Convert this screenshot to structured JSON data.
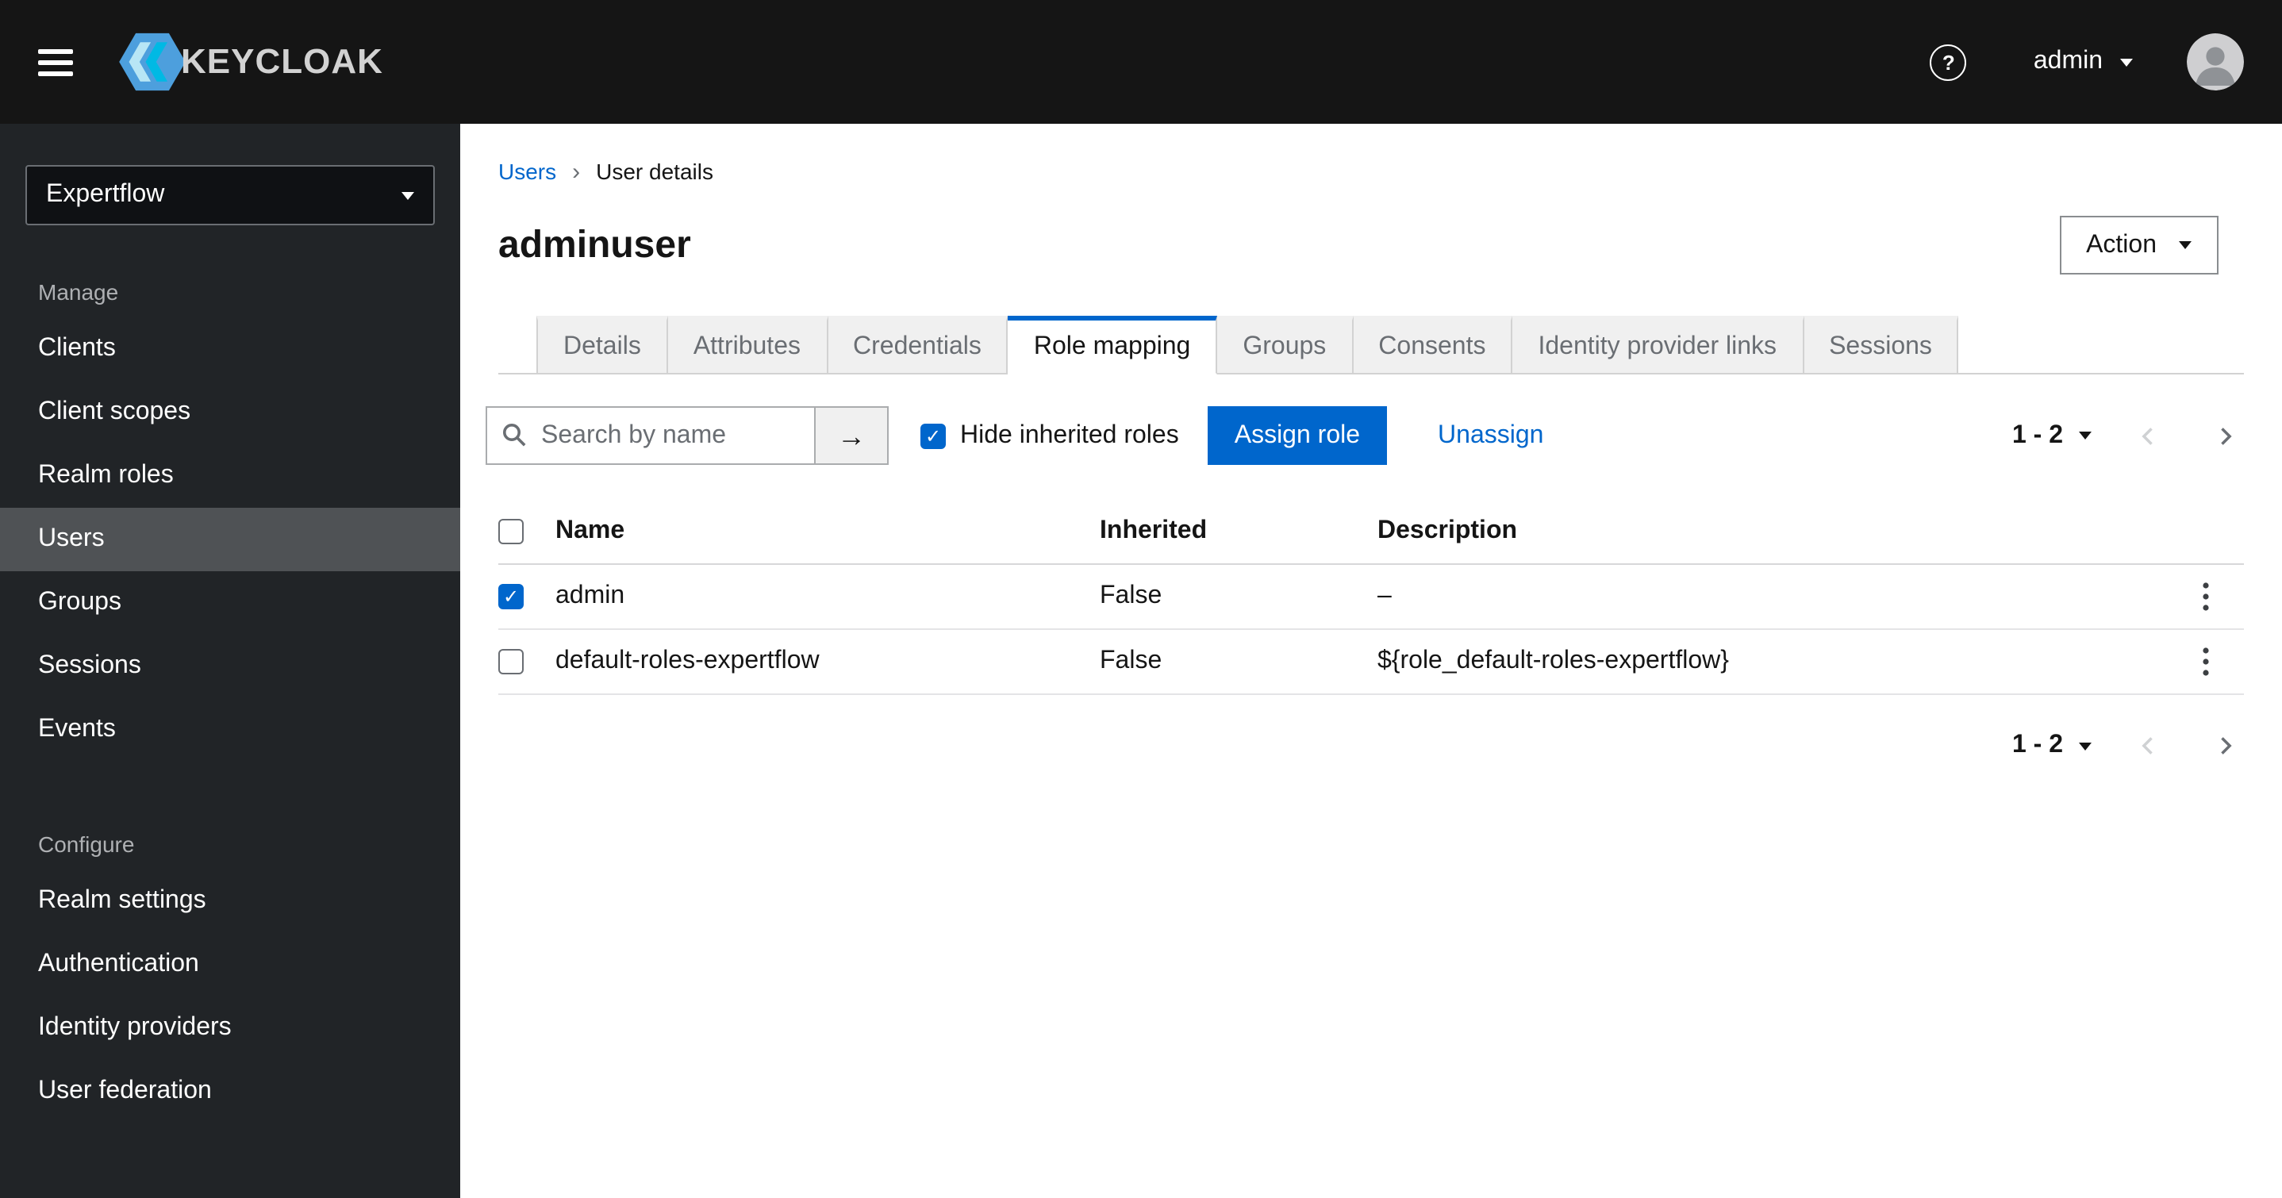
{
  "header": {
    "brand": "KEYCLOAK",
    "help_label": "?",
    "username": "admin"
  },
  "sidebar": {
    "realm": "Expertflow",
    "sections": [
      {
        "label": "Manage",
        "items": [
          {
            "label": "Clients"
          },
          {
            "label": "Client scopes"
          },
          {
            "label": "Realm roles"
          },
          {
            "label": "Users",
            "active": true
          },
          {
            "label": "Groups"
          },
          {
            "label": "Sessions"
          },
          {
            "label": "Events"
          }
        ]
      },
      {
        "label": "Configure",
        "items": [
          {
            "label": "Realm settings"
          },
          {
            "label": "Authentication"
          },
          {
            "label": "Identity providers"
          },
          {
            "label": "User federation"
          }
        ]
      }
    ]
  },
  "breadcrumb": {
    "parent": "Users",
    "current": "User details"
  },
  "page": {
    "title": "adminuser",
    "action_label": "Action"
  },
  "tabs": [
    {
      "label": "Details"
    },
    {
      "label": "Attributes"
    },
    {
      "label": "Credentials"
    },
    {
      "label": "Role mapping",
      "active": true
    },
    {
      "label": "Groups"
    },
    {
      "label": "Consents"
    },
    {
      "label": "Identity provider links"
    },
    {
      "label": "Sessions"
    }
  ],
  "toolbar": {
    "search_placeholder": "Search by name",
    "hide_inherited": {
      "label": "Hide inherited roles",
      "checked": true
    },
    "assign_label": "Assign role",
    "unassign_label": "Unassign",
    "pagination": {
      "range": "1 - 2"
    }
  },
  "table": {
    "columns": {
      "name": "Name",
      "inherited": "Inherited",
      "description": "Description"
    },
    "rows": [
      {
        "checked": true,
        "name": "admin",
        "inherited": "False",
        "description": "–"
      },
      {
        "checked": false,
        "name": "default-roles-expertflow",
        "inherited": "False",
        "description": "${role_default-roles-expertflow}"
      }
    ]
  },
  "colors": {
    "primary": "#0066cc",
    "masthead": "#151515",
    "sidebar": "#212427",
    "active_nav": "#4f5255"
  }
}
